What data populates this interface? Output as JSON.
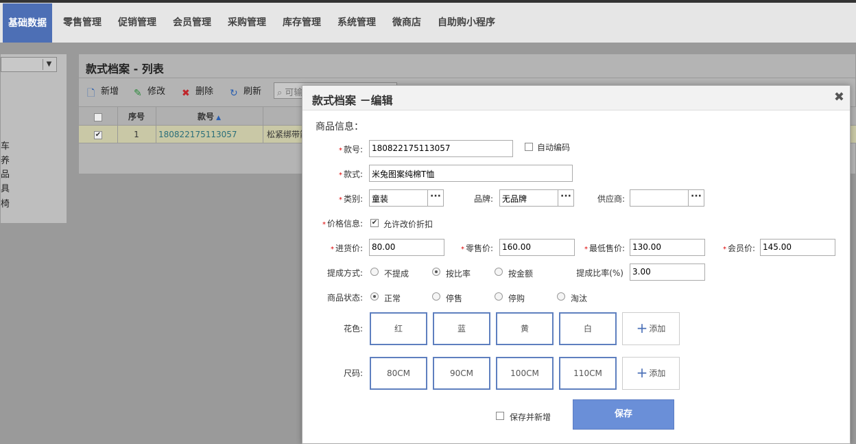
{
  "nav": [
    "基础数据",
    "零售管理",
    "促销管理",
    "会员管理",
    "采购管理",
    "库存管理",
    "系统管理",
    "微商店",
    "自助购小程序"
  ],
  "left_items": [
    "车",
    "养",
    "品",
    "具",
    "椅"
  ],
  "list": {
    "title": "款式档案 - 列表",
    "toolbar": {
      "add": "新增",
      "edit": "修改",
      "delete": "删除",
      "refresh": "刷新",
      "search_text": "可输"
    },
    "headers": {
      "seq": "序号",
      "code": "款号"
    },
    "row": {
      "seq": "1",
      "code": "180822175113057",
      "name": "松紧绑带箭"
    }
  },
  "modal": {
    "title": "款式档案 －编辑",
    "section": "商品信息：",
    "code_label": "款号:",
    "code_value": "180822175113057",
    "auto_code": "自动编码",
    "style_label": "款式:",
    "style_value": "米兔图案纯棉T恤",
    "category_label": "类别:",
    "category_value": "童装",
    "brand_label": "品牌:",
    "brand_value": "无品牌",
    "supplier_label": "供应商:",
    "supplier_value": "",
    "price_info_label": "价格信息:",
    "allow_discount": "允许改价折扣",
    "purchase_label": "进货价:",
    "purchase_value": "80.00",
    "retail_label": "零售价:",
    "retail_value": "160.00",
    "min_label": "最低售价:",
    "min_value": "130.00",
    "member_label": "会员价:",
    "member_value": "145.00",
    "commission_label": "提成方式:",
    "commission_options": [
      "不提成",
      "按比率",
      "按金额"
    ],
    "commission_rate_label": "提成比率(%)",
    "commission_rate_value": "3.00",
    "status_label": "商品状态:",
    "status_options": [
      "正常",
      "停售",
      "停购",
      "淘汰"
    ],
    "color_label": "花色:",
    "colors": [
      "红",
      "蓝",
      "黄",
      "白"
    ],
    "size_label": "尺码:",
    "sizes": [
      "80CM",
      "90CM",
      "100CM",
      "110CM"
    ],
    "add_label": "添加",
    "save_and_new": "保存并新增",
    "save": "保存"
  }
}
